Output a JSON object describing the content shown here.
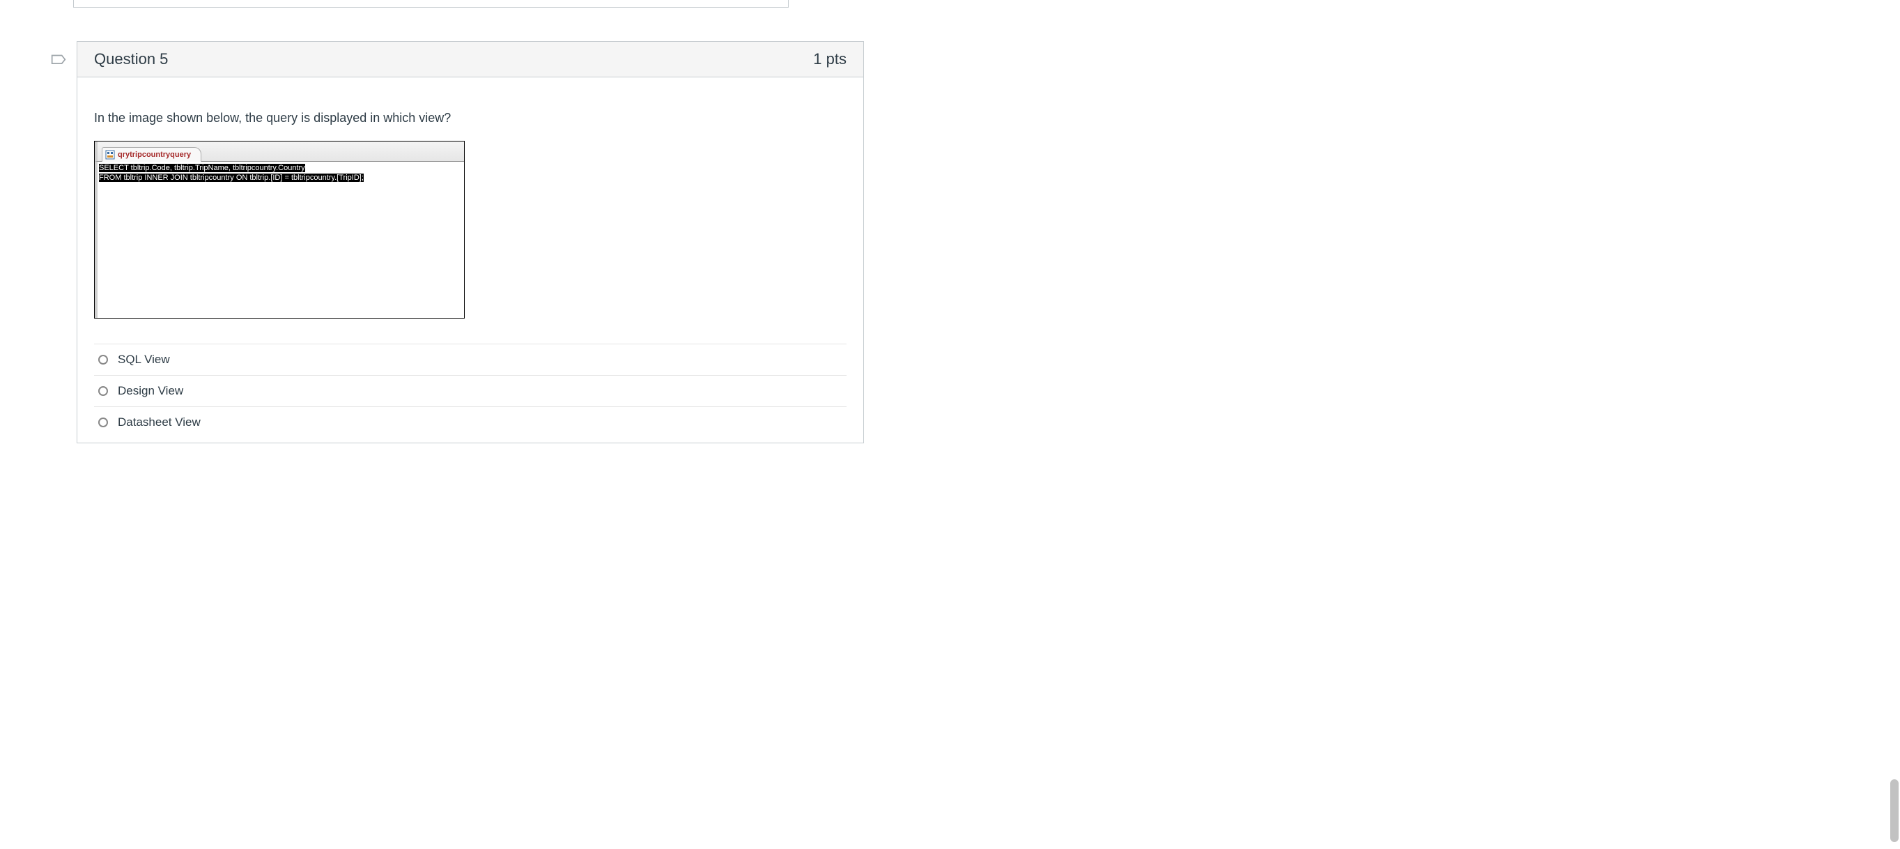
{
  "question": {
    "title": "Question 5",
    "points": "1 pts",
    "prompt": "In the image shown below, the query is displayed in which view?"
  },
  "sql": {
    "tab_name": "qrytripcountryquery",
    "line1": "SELECT tbltrip.Code, tbltrip.TripName, tbltripcountry.Country",
    "line2": "FROM tbltrip INNER JOIN tbltripcountry ON tbltrip.[ID] = tbltripcountry.[TripID];"
  },
  "options": [
    {
      "label": "SQL View"
    },
    {
      "label": "Design View"
    },
    {
      "label": "Datasheet View"
    }
  ]
}
